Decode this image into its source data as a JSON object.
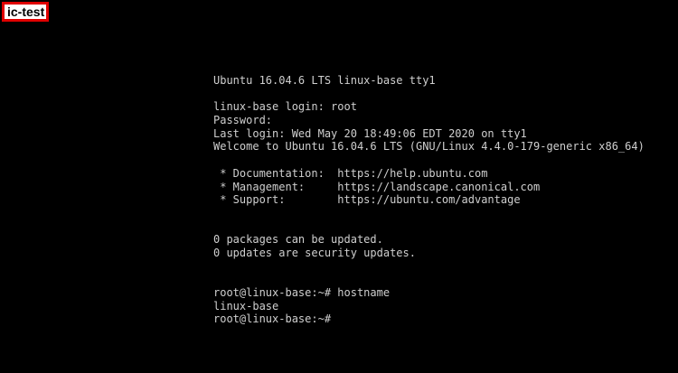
{
  "window": {
    "tab_label": "ic-test"
  },
  "terminal": {
    "lines": [
      "Ubuntu 16.04.6 LTS linux-base tty1",
      "",
      "linux-base login: root",
      "Password:",
      "Last login: Wed May 20 18:49:06 EDT 2020 on tty1",
      "Welcome to Ubuntu 16.04.6 LTS (GNU/Linux 4.4.0-179-generic x86_64)",
      "",
      " * Documentation:  https://help.ubuntu.com",
      " * Management:     https://landscape.canonical.com",
      " * Support:        https://ubuntu.com/advantage",
      "",
      "",
      "0 packages can be updated.",
      "0 updates are security updates.",
      "",
      "",
      "root@linux-base:~# hostname",
      "linux-base",
      "root@linux-base:~#"
    ]
  },
  "colors": {
    "background": "#000000",
    "text": "#cfcfcf",
    "tab_border": "#e00000"
  }
}
